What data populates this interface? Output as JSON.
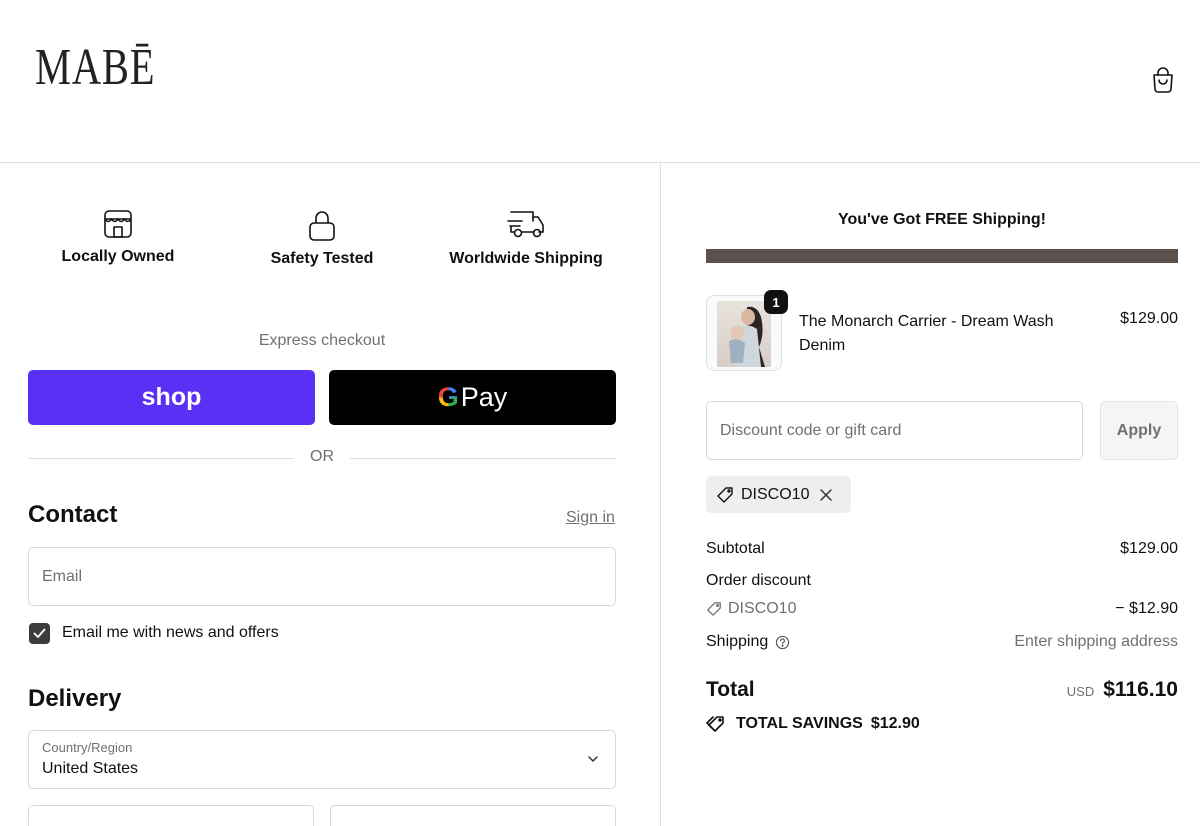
{
  "header": {
    "logo": "MABĒ",
    "cart_icon": "shopping-bag-icon"
  },
  "features": [
    {
      "icon": "storefront-icon",
      "label": "Locally Owned"
    },
    {
      "icon": "lock-icon",
      "label": "Safety Tested"
    },
    {
      "icon": "delivery-truck-icon",
      "label": "Worldwide Shipping"
    }
  ],
  "express": {
    "label": "Express checkout",
    "shop_label": "shop",
    "gpay_g": "G",
    "gpay_label": "Pay",
    "or": "OR"
  },
  "contact": {
    "title": "Contact",
    "sign_in": "Sign in",
    "email_placeholder": "Email",
    "newsletter_label": "Email me with news and offers",
    "newsletter_checked": true
  },
  "delivery": {
    "title": "Delivery",
    "country_label": "Country/Region",
    "country_value": "United States"
  },
  "summary": {
    "free_shipping_text": "You've Got FREE Shipping!",
    "progress_fraction": 1.0,
    "colors": {
      "progress": "#5b504b",
      "shop": "#5a31f4"
    },
    "product": {
      "quantity": "1",
      "name": "The Monarch Carrier - Dream Wash Denim",
      "price": "$129.00"
    },
    "discount_placeholder": "Discount code or gift card",
    "apply_label": "Apply",
    "applied_code": "DISCO10",
    "subtotal_label": "Subtotal",
    "subtotal_value": "$129.00",
    "order_discount_label": "Order discount",
    "discount_code": "DISCO10",
    "discount_value": "− $12.90",
    "shipping_label": "Shipping",
    "shipping_value": "Enter shipping address",
    "total_label": "Total",
    "currency": "USD",
    "total_value": "$116.10",
    "savings_label": "TOTAL SAVINGS",
    "savings_value": "$12.90"
  }
}
